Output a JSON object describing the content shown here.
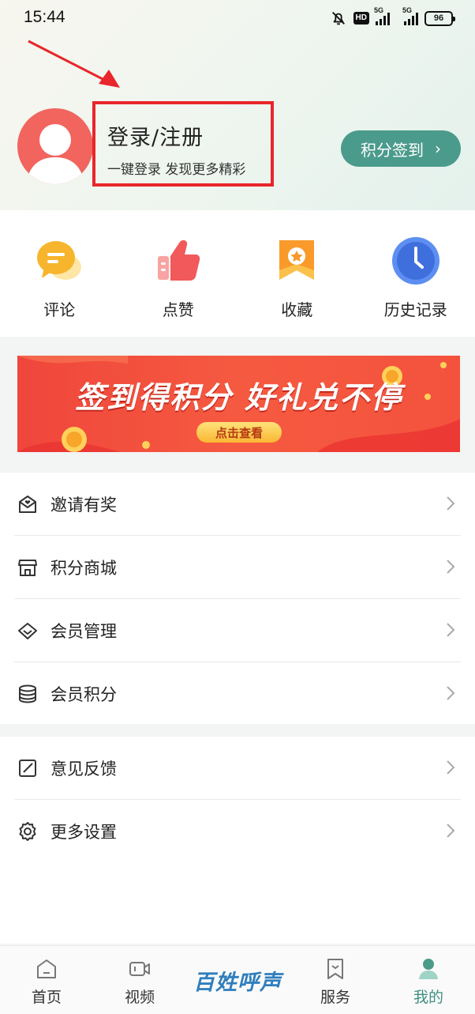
{
  "status_bar": {
    "time": "15:44",
    "hd": "HD",
    "net1": "5G",
    "net2": "5G",
    "battery": "96"
  },
  "profile": {
    "title": "登录/注册",
    "subtitle": "一键登录 发现更多精彩",
    "checkin_label": "积分签到",
    "checkin_chevron": "›"
  },
  "quick_actions": [
    {
      "label": "评论",
      "icon": "comment-icon"
    },
    {
      "label": "点赞",
      "icon": "thumbs-up-icon"
    },
    {
      "label": "收藏",
      "icon": "favorite-star-icon"
    },
    {
      "label": "历史记录",
      "icon": "history-clock-icon"
    }
  ],
  "banner": {
    "title": "签到得积分 好礼兑不停",
    "button": "点击查看"
  },
  "menu_group_1": [
    {
      "label": "邀请有奖",
      "icon": "invite-gift-icon"
    },
    {
      "label": "积分商城",
      "icon": "store-icon"
    },
    {
      "label": "会员管理",
      "icon": "diamond-icon"
    },
    {
      "label": "会员积分",
      "icon": "coins-stack-icon"
    }
  ],
  "menu_group_2": [
    {
      "label": "意见反馈",
      "icon": "feedback-edit-icon"
    },
    {
      "label": "更多设置",
      "icon": "gear-icon"
    }
  ],
  "tabbar": {
    "items": [
      {
        "label": "首页",
        "icon": "home-icon"
      },
      {
        "label": "视频",
        "icon": "video-icon"
      },
      {
        "label": "服务",
        "icon": "service-bookmark-icon"
      },
      {
        "label": "我的",
        "icon": "person-icon"
      }
    ],
    "logo": "百姓呼声",
    "active_color": "#3f8f7f"
  },
  "colors": {
    "accent": "#4b9b8c",
    "highlight_box": "#e8262b",
    "avatar": "#f2645e"
  }
}
